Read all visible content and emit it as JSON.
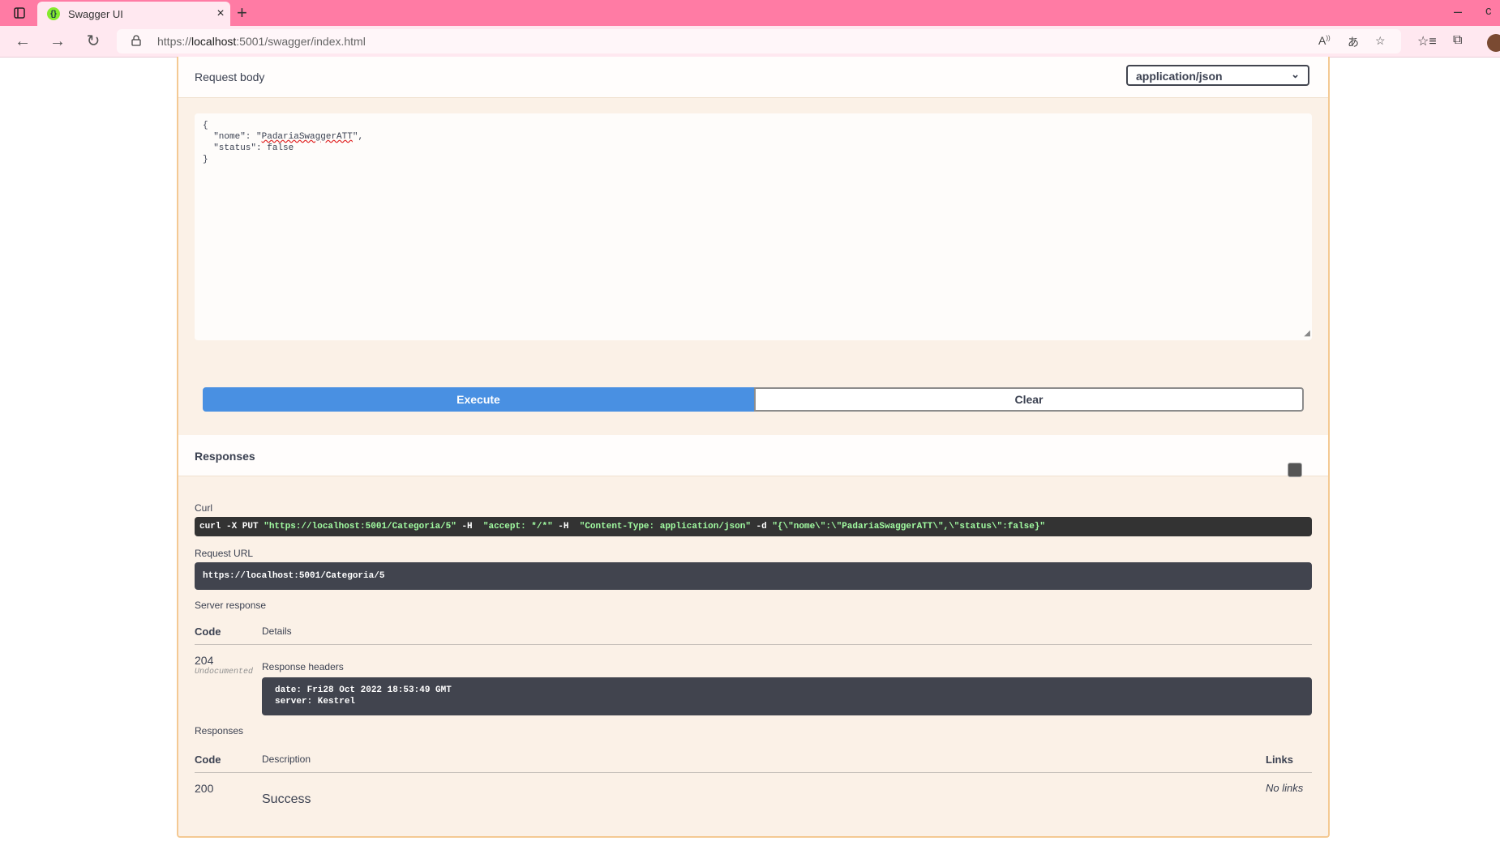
{
  "browser": {
    "tab_title": "Swagger UI",
    "favicon": "{}",
    "close": "×",
    "new_tab": "+",
    "minimize": "–",
    "cut_text": "c",
    "url_prefix": "https://",
    "url_host": "localhost",
    "url_rest": ":5001/swagger/index.html",
    "icons": [
      "tab-actions-icon",
      "back-icon",
      "forward-icon",
      "refresh-icon",
      "lock-icon",
      "read-aloud-icon",
      "translate-icon",
      "add-favorite-icon",
      "favorites-icon",
      "collections-icon",
      "profile-avatar"
    ]
  },
  "request_body": {
    "title": "Request body",
    "content_type": "application/json",
    "json_open": "{",
    "json_nome_key": "  \"nome\": \"",
    "json_nome_value": "PadariaSwaggerATT",
    "json_nome_end": "\",",
    "json_status_line": "  \"status\": false",
    "json_close": "}"
  },
  "buttons": {
    "execute": "Execute",
    "clear": "Clear"
  },
  "responses": {
    "title": "Responses",
    "curl_label": "Curl",
    "curl_cmd1": "curl -X PUT ",
    "curl_url": "\"https://localhost:5001/Categoria/5\"",
    "curl_h1": " -H  ",
    "curl_accept": "\"accept: */*\"",
    "curl_h2": " -H  ",
    "curl_ctype": "\"Content-Type: application/json\"",
    "curl_d": " -d ",
    "curl_data": "\"{\\\"nome\\\":\\\"PadariaSwaggerATT\\\",\\\"status\\\":false}\"",
    "request_url_label": "Request URL",
    "request_url": "https://localhost:5001/Categoria/5",
    "server_response_label": "Server response",
    "col_code": "Code",
    "col_details": "Details",
    "server_code": "204",
    "server_code_note": "Undocumented",
    "response_headers_label": "Response headers",
    "response_headers": "date: Fri28 Oct 2022 18:53:49 GMT\nserver: Kestrel",
    "responses_label": "Responses",
    "col_description": "Description",
    "col_links": "Links",
    "doc_code": "200",
    "doc_description": "Success",
    "doc_links": "No links"
  }
}
